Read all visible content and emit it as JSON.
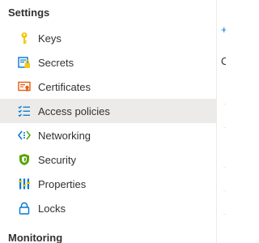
{
  "sidebar": {
    "section_title": "Settings",
    "next_section_title": "Monitoring",
    "items": [
      {
        "label": "Keys",
        "icon": "key-icon",
        "selected": false
      },
      {
        "label": "Secrets",
        "icon": "secret-icon",
        "selected": false
      },
      {
        "label": "Certificates",
        "icon": "certificate-icon",
        "selected": false
      },
      {
        "label": "Access policies",
        "icon": "access-policies-icon",
        "selected": true
      },
      {
        "label": "Networking",
        "icon": "networking-icon",
        "selected": false
      },
      {
        "label": "Security",
        "icon": "shield-icon",
        "selected": false
      },
      {
        "label": "Properties",
        "icon": "properties-icon",
        "selected": false
      },
      {
        "label": "Locks",
        "icon": "lock-icon",
        "selected": false
      }
    ]
  },
  "pane": {
    "add_glyph": "+",
    "partial_text": "C"
  },
  "colors": {
    "selected_bg": "#edebe9",
    "accent": "#0078d4",
    "key_yellow": "#f2c811",
    "security_green": "#57a300"
  }
}
